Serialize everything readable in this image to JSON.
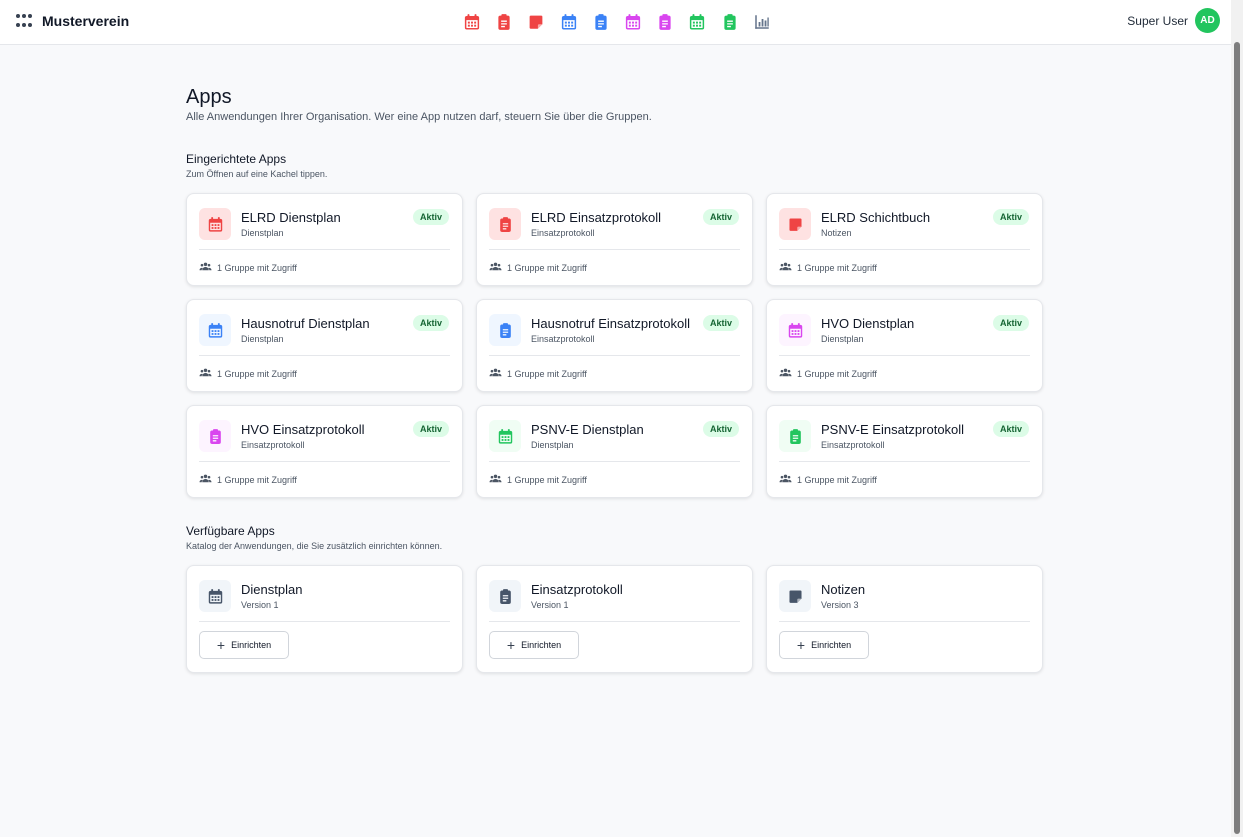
{
  "header": {
    "brand": "Musterverein",
    "user_name": "Super User",
    "avatar_initials": "AD",
    "app_shortcuts": [
      {
        "icon": "calendar-icon",
        "color": "#ef4444"
      },
      {
        "icon": "clipboard-icon",
        "color": "#ef4444"
      },
      {
        "icon": "sticky-note-icon",
        "color": "#ef4444"
      },
      {
        "icon": "calendar-icon",
        "color": "#3b82f6"
      },
      {
        "icon": "clipboard-icon",
        "color": "#3b82f6"
      },
      {
        "icon": "calendar-icon",
        "color": "#d946ef"
      },
      {
        "icon": "clipboard-icon",
        "color": "#d946ef"
      },
      {
        "icon": "calendar-icon",
        "color": "#22c55e"
      },
      {
        "icon": "clipboard-icon",
        "color": "#22c55e"
      },
      {
        "icon": "chart-icon",
        "color": "#64748b"
      }
    ]
  },
  "page": {
    "title": "Apps",
    "subtitle": "Alle Anwendungen Ihrer Organisation. Wer eine App nutzen darf, steuern Sie über die Gruppen."
  },
  "installed": {
    "title": "Eingerichtete Apps",
    "subtitle": "Zum Öffnen auf eine Kachel tippen.",
    "apps": [
      {
        "name": "ELRD Dienstplan",
        "type": "Dienstplan",
        "status": "Aktiv",
        "access": "1 Gruppe mit Zugriff",
        "icon": "calendar-icon",
        "color": "#ef4444",
        "bg": "#fee2e2"
      },
      {
        "name": "ELRD Einsatzprotokoll",
        "type": "Einsatzprotokoll",
        "status": "Aktiv",
        "access": "1 Gruppe mit Zugriff",
        "icon": "clipboard-icon",
        "color": "#ef4444",
        "bg": "#fee2e2"
      },
      {
        "name": "ELRD Schichtbuch",
        "type": "Notizen",
        "status": "Aktiv",
        "access": "1 Gruppe mit Zugriff",
        "icon": "sticky-note-icon",
        "color": "#ef4444",
        "bg": "#fee2e2"
      },
      {
        "name": "Hausnotruf Dienstplan",
        "type": "Dienstplan",
        "status": "Aktiv",
        "access": "1 Gruppe mit Zugriff",
        "icon": "calendar-icon",
        "color": "#3b82f6",
        "bg": "#eff6ff"
      },
      {
        "name": "Hausnotruf Einsatzprotokoll",
        "type": "Einsatzprotokoll",
        "status": "Aktiv",
        "access": "1 Gruppe mit Zugriff",
        "icon": "clipboard-icon",
        "color": "#3b82f6",
        "bg": "#eff6ff"
      },
      {
        "name": "HVO Dienstplan",
        "type": "Dienstplan",
        "status": "Aktiv",
        "access": "1 Gruppe mit Zugriff",
        "icon": "calendar-icon",
        "color": "#d946ef",
        "bg": "#fdf4ff"
      },
      {
        "name": "HVO Einsatzprotokoll",
        "type": "Einsatzprotokoll",
        "status": "Aktiv",
        "access": "1 Gruppe mit Zugriff",
        "icon": "clipboard-icon",
        "color": "#d946ef",
        "bg": "#fdf4ff"
      },
      {
        "name": "PSNV-E Dienstplan",
        "type": "Dienstplan",
        "status": "Aktiv",
        "access": "1 Gruppe mit Zugriff",
        "icon": "calendar-icon",
        "color": "#22c55e",
        "bg": "#f0fdf4"
      },
      {
        "name": "PSNV-E Einsatzprotokoll",
        "type": "Einsatzprotokoll",
        "status": "Aktiv",
        "access": "1 Gruppe mit Zugriff",
        "icon": "clipboard-icon",
        "color": "#22c55e",
        "bg": "#f0fdf4"
      }
    ]
  },
  "available": {
    "title": "Verfügbare Apps",
    "subtitle": "Katalog der Anwendungen, die Sie zusätzlich einrichten können.",
    "button_label": "Einrichten",
    "apps": [
      {
        "name": "Dienstplan",
        "version": "Version 1",
        "icon": "calendar-icon",
        "color": "#475569",
        "bg": "#f1f5f9"
      },
      {
        "name": "Einsatzprotokoll",
        "version": "Version 1",
        "icon": "clipboard-icon",
        "color": "#475569",
        "bg": "#f1f5f9"
      },
      {
        "name": "Notizen",
        "version": "Version 3",
        "icon": "sticky-note-icon",
        "color": "#475569",
        "bg": "#f1f5f9"
      }
    ]
  }
}
